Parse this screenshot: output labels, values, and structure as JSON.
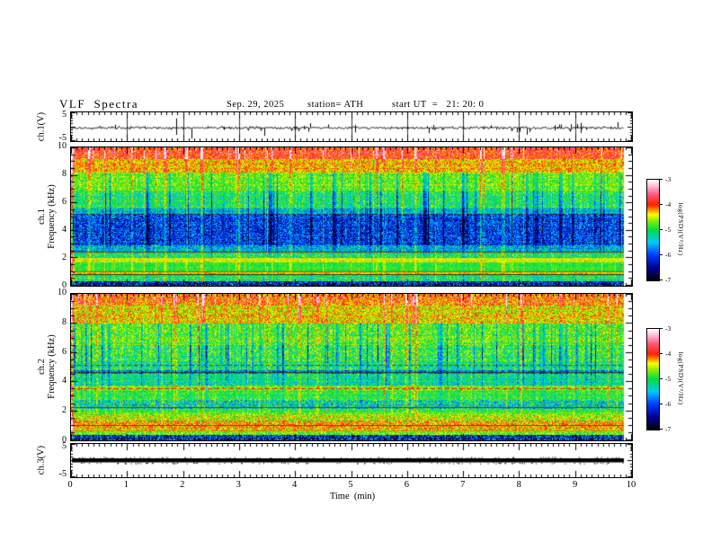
{
  "header": {
    "title": "VLF  Spectra",
    "date": "Sep. 29, 2025",
    "station": "station= ATH",
    "start_ut": "start UT  =   21: 20: 0"
  },
  "axes": {
    "time_label": "Time  (min)",
    "time_ticks": [
      0,
      1,
      2,
      3,
      4,
      5,
      6,
      7,
      8,
      9,
      10
    ],
    "time_minor_step": 0.1,
    "freq_ticks": [
      10,
      8,
      6,
      4,
      2,
      0
    ],
    "freq_minor_step": 0.5,
    "volt_ticks": [
      5,
      -5
    ]
  },
  "panels": {
    "ch1_wave": {
      "ylabel": "ch.1(V)",
      "ymin": -5,
      "ymax": 5
    },
    "ch1_spec": {
      "ylabel1": "ch.1",
      "ylabel2": "Frequency  (kHz)",
      "ymin": 0,
      "ymax": 10
    },
    "ch2_spec": {
      "ylabel1": "ch.2",
      "ylabel2": "Frequency  (kHz)",
      "ymin": 0,
      "ymax": 10
    },
    "ch3_wave": {
      "ylabel": "ch.3(V)",
      "ymin": -5,
      "ymax": 5
    }
  },
  "colorbar": {
    "label": "log(PSD)(V²/Hz)",
    "ticks": [
      -3,
      -4,
      -5,
      -6,
      -7
    ],
    "stops": [
      {
        "v": -7.0,
        "c": "#000006"
      },
      {
        "v": -6.5,
        "c": "#000095"
      },
      {
        "v": -6.0,
        "c": "#0038ff"
      },
      {
        "v": -5.5,
        "c": "#00c8ff"
      },
      {
        "v": -5.0,
        "c": "#00dd44"
      },
      {
        "v": -4.6,
        "c": "#99ee00"
      },
      {
        "v": -4.38,
        "c": "#ffff00"
      },
      {
        "v": -4.18,
        "c": "#ff8800"
      },
      {
        "v": -4.0,
        "c": "#ff2200"
      },
      {
        "v": -3.6,
        "c": "#ff5577"
      },
      {
        "v": -3.25,
        "c": "#ffbbdd"
      },
      {
        "v": -3.0,
        "c": "#ffffff"
      }
    ]
  },
  "chart_data": [
    {
      "type": "line",
      "name": "ch1_waveform",
      "ylabel": "ch.1(V)",
      "x_range": [
        0,
        10
      ],
      "y_range": [
        -5,
        5
      ],
      "series_color": "#000000",
      "baseline": -0.55,
      "noise_sigma": 0.35,
      "spike_rate": 0.06,
      "spike_max": 4,
      "data_end_min": 9.84,
      "description": "noisy telluric voltage trace with frequent bipolar impulsive spikes"
    },
    {
      "type": "heatmap",
      "name": "ch1_spectrogram",
      "ylabel": "ch.1 Frequency (kHz)",
      "x_range": [
        0,
        10
      ],
      "y_range": [
        0,
        10
      ],
      "value_label": "log(PSD)(V²/Hz)",
      "value_range": [
        -7,
        -3
      ],
      "red_bleed": 0.45,
      "bands": [
        {
          "f": [
            9.2,
            10
          ],
          "level": -4.05,
          "noise": 0.45,
          "streak": 0.75
        },
        {
          "f": [
            8.2,
            9.2
          ],
          "level": -4.4,
          "noise": 0.4,
          "streak": 0.45
        },
        {
          "f": [
            6.8,
            8.2
          ],
          "level": -4.7,
          "noise": 0.38,
          "streak": -0.5
        },
        {
          "f": [
            5.6,
            6.8
          ],
          "level": -4.95,
          "noise": 0.45,
          "streak": -0.7
        },
        {
          "f": [
            5.2,
            5.6
          ],
          "level": -5.4,
          "noise": 0.5,
          "streak": -0.7
        },
        {
          "f": [
            2.9,
            5.2
          ],
          "level": -6.0,
          "noise": 0.65,
          "streak": -0.55
        },
        {
          "f": [
            2.4,
            2.9
          ],
          "level": -5.5,
          "noise": 0.6,
          "streak": -0.3
        },
        {
          "f": [
            2.02,
            2.4
          ],
          "level": -5.15,
          "noise": 0.5,
          "streak": -0.2
        },
        {
          "f": [
            1.68,
            2.02
          ],
          "level": -4.45,
          "noise": 0.25,
          "streak": 0
        },
        {
          "f": [
            0.95,
            1.68
          ],
          "level": -4.95,
          "noise": 0.2,
          "streak": -0.1
        },
        {
          "f": [
            0.78,
            0.95
          ],
          "level": -4.35,
          "noise": 0.3,
          "streak": 0
        },
        {
          "f": [
            0.3,
            0.78
          ],
          "level": -5.05,
          "noise": 0.5,
          "streak": -0.2
        },
        {
          "f": [
            0,
            0.3
          ],
          "level": -6.3,
          "noise": 0.9,
          "streak": 0
        }
      ],
      "hlines": [
        {
          "f": 5.15,
          "color": "#442222",
          "dash": [
            4,
            3
          ]
        },
        {
          "f": 2.42,
          "color": "#774400",
          "dash": []
        },
        {
          "f": 0.97,
          "color": "#bb5500",
          "dash": []
        },
        {
          "f": 0.78,
          "color": "#333300",
          "dash": []
        }
      ]
    },
    {
      "type": "heatmap",
      "name": "ch2_spectrogram",
      "ylabel": "ch.2 Frequency (kHz)",
      "x_range": [
        0,
        10
      ],
      "y_range": [
        0,
        10
      ],
      "value_label": "log(PSD)(V²/Hz)",
      "value_range": [
        -7,
        -3
      ],
      "red_bleed": 0.4,
      "bands": [
        {
          "f": [
            9.2,
            10
          ],
          "level": -4.3,
          "noise": 0.5,
          "streak": 0.8
        },
        {
          "f": [
            8.0,
            9.2
          ],
          "level": -4.5,
          "noise": 0.45,
          "streak": 0.5
        },
        {
          "f": [
            6.5,
            8.0
          ],
          "level": -4.75,
          "noise": 0.45,
          "streak": -0.55
        },
        {
          "f": [
            5.4,
            6.5
          ],
          "level": -4.85,
          "noise": 0.5,
          "streak": -0.75
        },
        {
          "f": [
            4.8,
            5.4
          ],
          "level": -5.0,
          "noise": 0.5,
          "streak": -0.5
        },
        {
          "f": [
            4.55,
            4.8
          ],
          "level": -5.75,
          "noise": 0.6,
          "streak": -0.3
        },
        {
          "f": [
            3.75,
            4.55
          ],
          "level": -5.15,
          "noise": 0.5,
          "streak": -0.35
        },
        {
          "f": [
            3.42,
            3.75
          ],
          "level": -4.75,
          "noise": 0.5,
          "streak": -0.2
        },
        {
          "f": [
            2.75,
            3.42
          ],
          "level": -4.9,
          "noise": 0.35,
          "streak": -0.2
        },
        {
          "f": [
            2.15,
            2.75
          ],
          "level": -5.35,
          "noise": 0.7,
          "streak": -0.1
        },
        {
          "f": [
            1.8,
            2.15
          ],
          "level": -4.9,
          "noise": 0.3,
          "streak": -0.1
        },
        {
          "f": [
            1.35,
            1.8
          ],
          "level": -4.6,
          "noise": 0.5,
          "streak": 0
        },
        {
          "f": [
            0.6,
            1.35
          ],
          "level": -4.25,
          "noise": 0.5,
          "streak": 0
        },
        {
          "f": [
            0.35,
            0.6
          ],
          "level": -4.7,
          "noise": 0.5,
          "streak": 0
        },
        {
          "f": [
            0,
            0.35
          ],
          "level": -6.2,
          "noise": 0.95,
          "streak": 0
        }
      ],
      "hlines": [
        {
          "f": 5.15,
          "color": "#883322",
          "dash": [
            4,
            3
          ]
        },
        {
          "f": 4.62,
          "color": "#333322",
          "dash": []
        },
        {
          "f": 3.5,
          "color": "#ee2200",
          "dash": [
            5,
            3
          ]
        },
        {
          "f": 2.25,
          "color": "#883311",
          "dash": []
        },
        {
          "f": 1.0,
          "color": "#cc2200",
          "dash": []
        },
        {
          "f": 0.62,
          "color": "#aaaa00",
          "dash": []
        }
      ]
    },
    {
      "type": "line",
      "name": "ch3_waveform",
      "ylabel": "ch.3(V)",
      "x_range": [
        0,
        10
      ],
      "y_range": [
        -5,
        5
      ],
      "series_color": "#000000",
      "constant_value": 0,
      "line_thickness_v": 0.55,
      "data_end_min": 9.84,
      "description": "flat (dead/constant) channel drawn as a thick black line at 0 V"
    }
  ]
}
